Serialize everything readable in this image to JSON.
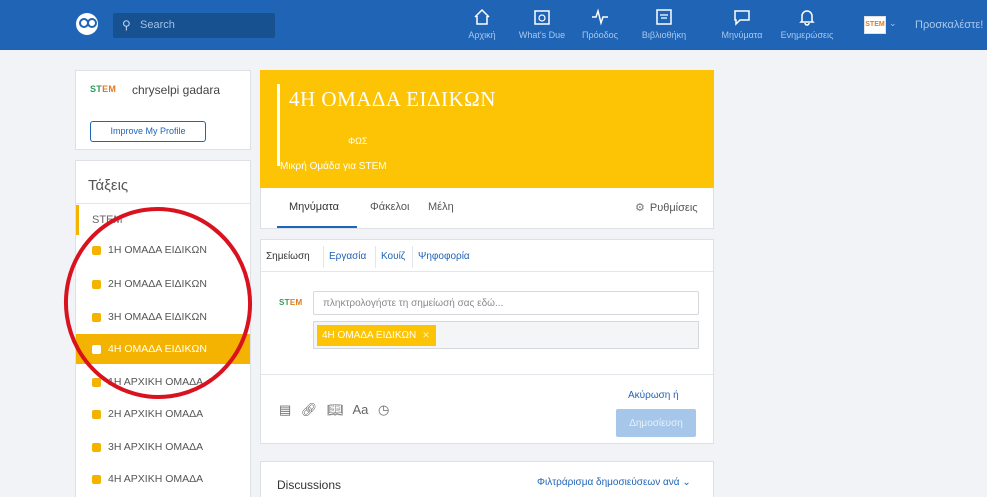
{
  "nav": {
    "search_placeholder": "Search",
    "items": [
      {
        "label": "Αρχική",
        "icon": "home-icon"
      },
      {
        "label": "What's Due",
        "icon": "calendar-icon"
      },
      {
        "label": "Πρόοδος",
        "icon": "progress-icon"
      },
      {
        "label": "Βιβλιοθήκη",
        "icon": "library-icon"
      },
      {
        "label": "Μηνύματα",
        "icon": "message-icon"
      },
      {
        "label": "Ενημερώσεις",
        "icon": "bell-icon"
      }
    ],
    "avatar_text": "STEM",
    "invite_label": "Προσκαλέστε!"
  },
  "profile": {
    "logo_text_a": "ST",
    "logo_text_b": "EM",
    "name": "chryselpi gadara",
    "improve_label": "Improve My Profile"
  },
  "classes": {
    "heading": "Τάξεις",
    "group_label": "STEM",
    "items": [
      {
        "label": "1Η ΟΜΑΔΑ ΕΙΔΙΚΩΝ",
        "active": false
      },
      {
        "label": "2Η ΟΜΑΔΑ ΕΙΔΙΚΩΝ",
        "active": false
      },
      {
        "label": "3Η ΟΜΑΔΑ ΕΙΔΙΚΩΝ",
        "active": false
      },
      {
        "label": "4Η ΟΜΑΔΑ ΕΙΔΙΚΩΝ",
        "active": true
      },
      {
        "label": "1Η ΑΡΧΙΚΗ ΟΜΑΔΑ",
        "active": false
      },
      {
        "label": "2Η ΑΡΧΙΚΗ ΟΜΑΔΑ",
        "active": false
      },
      {
        "label": "3Η ΑΡΧΙΚΗ ΟΜΑΔΑ",
        "active": false
      },
      {
        "label": "4Η ΑΡΧΙΚΗ ΟΜΑΔΑ",
        "active": false
      }
    ]
  },
  "group": {
    "title": "4Η ΟΜΑΔΑ ΕΙΔΙΚΩΝ",
    "subject": "ΦΩΣ",
    "description": "Μικρή Ομάδα για STEM"
  },
  "group_tabs": {
    "messages": "Μηνύματα",
    "folders": "Φάκελοι",
    "members": "Μέλη",
    "settings": "Ρυθμίσεις"
  },
  "composer": {
    "tabs": [
      "Σημείωση",
      "Εργασία",
      "Κουίζ",
      "Ψηφοφορία"
    ],
    "note_placeholder": "πληκτρολογήστε τη σημείωσή σας εδώ...",
    "recipient_chip": "4Η ΟΜΑΔΑ ΕΙΔΙΚΩΝ",
    "tool_icons": [
      "attach-file-icon",
      "link-icon",
      "library-icon",
      "text-format-icon",
      "clock-icon"
    ],
    "text_format_label": "Aa",
    "cancel_label": "Ακύρωση ή",
    "post_label": "Δημοσίευση"
  },
  "discussions": {
    "title": "Discussions",
    "filter_label": "Φιλτράρισμα δημοσιεύσεων ανά"
  },
  "colors": {
    "nav_blue": "#1f64b5",
    "accent_yellow": "#fcc404",
    "annotation_red": "#d9121f"
  }
}
